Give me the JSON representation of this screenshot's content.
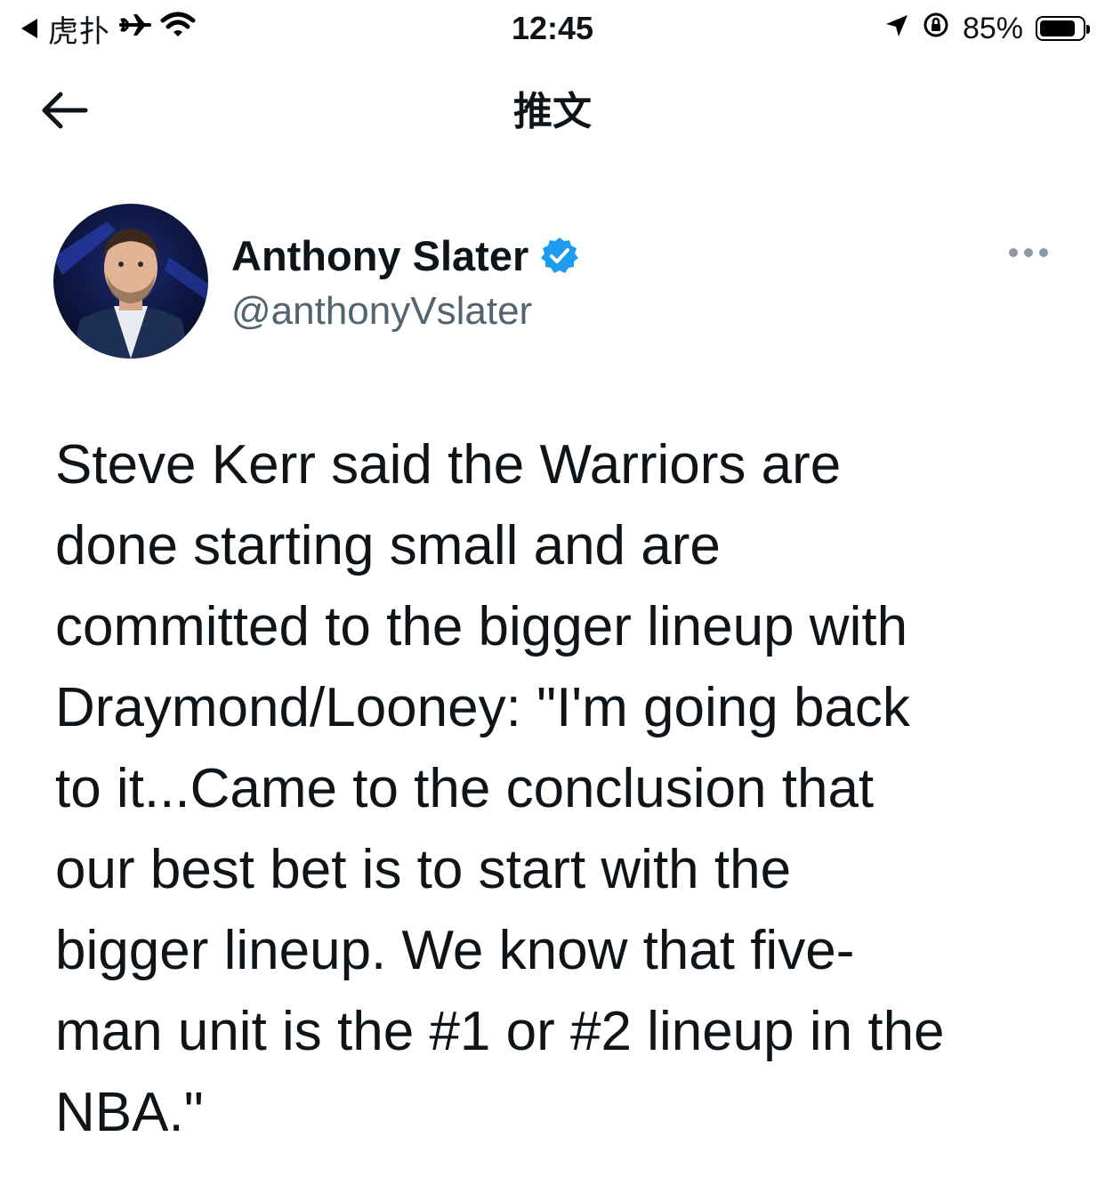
{
  "status_bar": {
    "back_app": "虎扑",
    "time": "12:45",
    "battery_percent": "85%",
    "battery_level": 0.85
  },
  "header": {
    "title": "推文"
  },
  "tweet": {
    "author": {
      "display_name": "Anthony Slater",
      "handle": "@anthonyVslater",
      "verified": true
    },
    "text_lines": [
      "Steve Kerr said the Warriors are",
      "done starting small and are",
      "committed to the bigger lineup with",
      "Draymond/Looney: \"I'm going back",
      "to it...Came to the conclusion that",
      "our best bet is to start with the",
      "bigger lineup. We know that five-",
      "man unit is the #1 or #2 lineup in the",
      "NBA.\""
    ]
  },
  "colors": {
    "text": "#0f1419",
    "secondary_text": "#536471",
    "verified_badge": "#1d9bf0",
    "more_dots": "#8b98a5"
  },
  "icons": {
    "status_back": "back-triangle-icon",
    "airplane": "airplane-icon",
    "wifi": "wifi-icon",
    "location": "location-arrow-icon",
    "rotation_lock": "rotation-lock-icon",
    "battery": "battery-icon",
    "nav_back": "arrow-left-icon",
    "verified": "verified-badge-icon",
    "more": "more-horizontal-icon"
  }
}
